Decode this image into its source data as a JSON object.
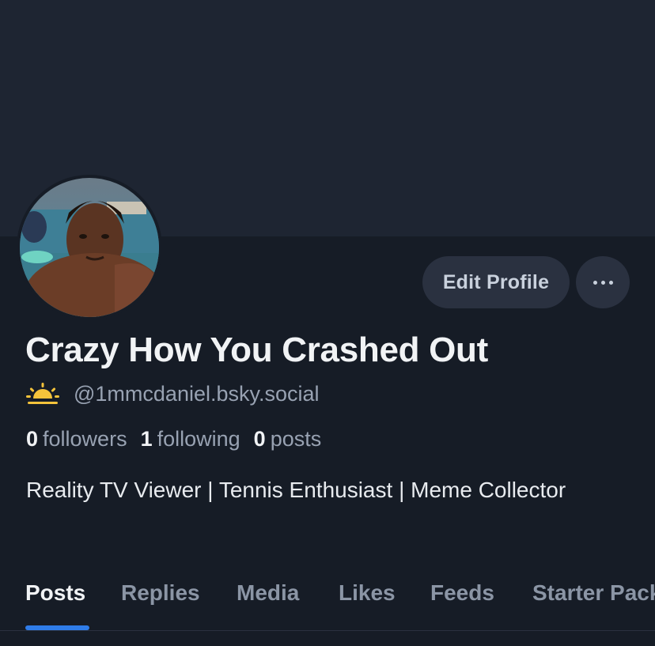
{
  "profile": {
    "display_name": "Crazy How You Crashed Out",
    "handle": "@1mmcdaniel.bsky.social",
    "bio": "Reality TV Viewer | Tennis Enthusiast | Meme Collector",
    "avatar_icon": "profile-photo",
    "handle_icon": "sunrise-icon"
  },
  "actions": {
    "edit_label": "Edit Profile",
    "more_icon": "ellipsis-icon"
  },
  "stats": {
    "followers_count": "0",
    "followers_label": "followers",
    "following_count": "1",
    "following_label": "following",
    "posts_count": "0",
    "posts_label": "posts"
  },
  "tabs": [
    {
      "label": "Posts",
      "active": true
    },
    {
      "label": "Replies",
      "active": false
    },
    {
      "label": "Media",
      "active": false
    },
    {
      "label": "Likes",
      "active": false
    },
    {
      "label": "Feeds",
      "active": false
    },
    {
      "label": "Starter Packs",
      "active": false
    }
  ],
  "colors": {
    "background": "#161c26",
    "banner": "#1e2532",
    "accent": "#2f7ce8",
    "button_bg": "#2a3140",
    "sun": "#f5c33b"
  }
}
